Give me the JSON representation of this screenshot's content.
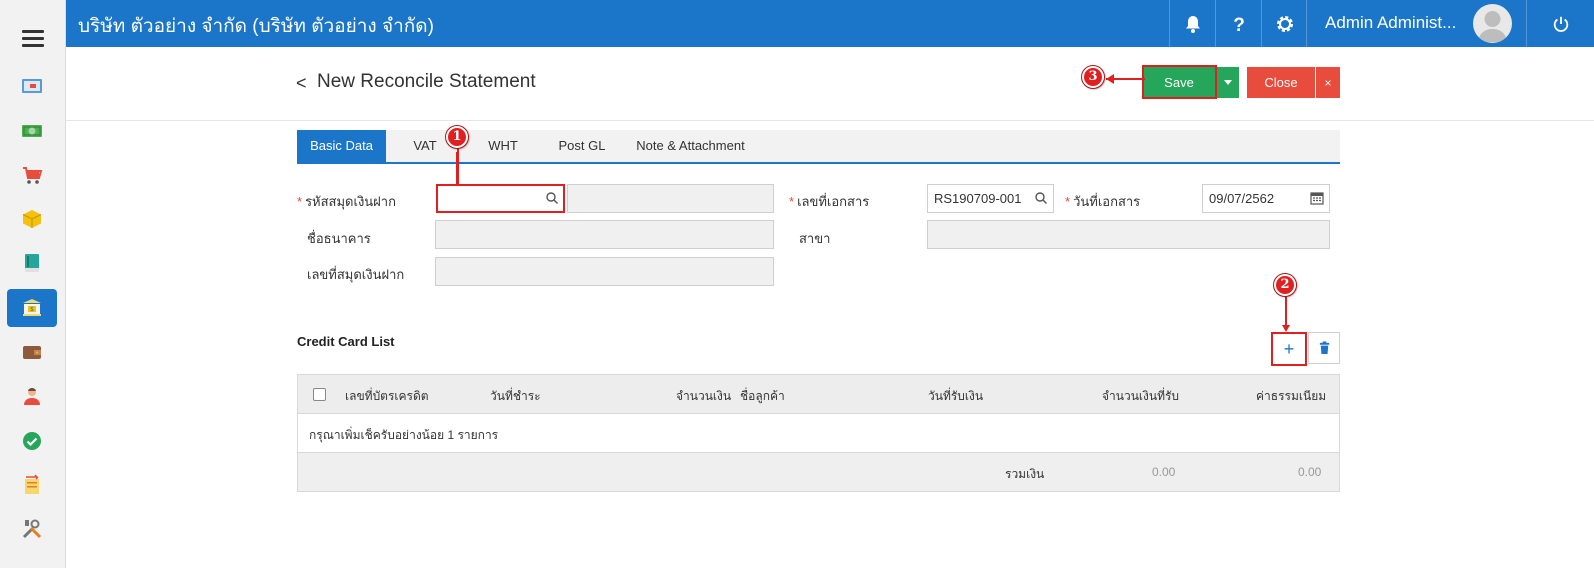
{
  "app": {
    "company": "บริษัท ตัวอย่าง จำกัด (บริษัท ตัวอย่าง จำกัด)",
    "user_name": "Admin Administ...",
    "brand_color": "#1b76c9"
  },
  "sidebar": {
    "items": [
      {
        "name": "dashboard-icon"
      },
      {
        "name": "money-icon"
      },
      {
        "name": "cart-icon"
      },
      {
        "name": "box-icon"
      },
      {
        "name": "book-icon"
      },
      {
        "name": "bank-icon",
        "active": true
      },
      {
        "name": "wallet-icon"
      },
      {
        "name": "user-icon"
      },
      {
        "name": "check-icon"
      },
      {
        "name": "transfer-icon"
      },
      {
        "name": "tools-icon"
      }
    ]
  },
  "header": {
    "back_symbol": "<",
    "title": "New Reconcile Statement",
    "save_label": "Save",
    "close_label": "Close",
    "close_x": "×"
  },
  "tabs": [
    "Basic Data",
    "VAT",
    "WHT",
    "Post GL",
    "Note & Attachment"
  ],
  "form": {
    "bankbook_code_label": "รหัสสมุดเงินฝาก",
    "bankbook_code_value": "",
    "bank_name_label": "ชื่อธนาคาร",
    "bankbook_no_label": "เลขที่สมุดเงินฝาก",
    "doc_no_label": "เลขที่เอกสาร",
    "doc_no_value": "RS190709-001",
    "doc_date_label": "วันที่เอกสาร",
    "doc_date_value": "09/07/2562",
    "branch_label": "สาขา"
  },
  "credit_card_list": {
    "title": "Credit Card List",
    "add_symbol": "+",
    "columns": [
      "เลขที่บัตรเครดิต",
      "วันที่ชำระ",
      "จำนวนเงิน",
      "ชื่อลูกค้า",
      "วันที่รับเงิน",
      "จำนวนเงินที่รับ",
      "ค่าธรรมเนียม"
    ],
    "empty_message": "กรุณาเพิ่มเช็ครับอย่างน้อย 1 รายการ",
    "total_label": "รวมเงิน",
    "total_received": "0.00",
    "total_fee": "0.00"
  },
  "annotations": {
    "step1": "1",
    "step2": "2",
    "step3": "3"
  }
}
